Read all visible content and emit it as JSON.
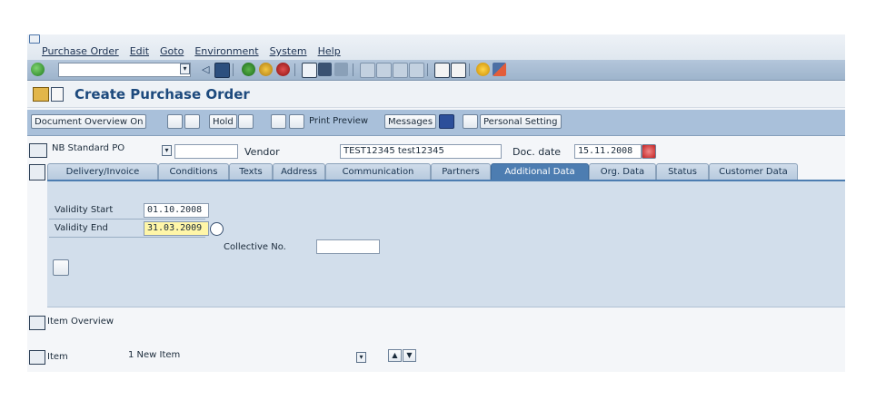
{
  "menu": [
    "Purchase Order",
    "Edit",
    "Goto",
    "Environment",
    "System",
    "Help"
  ],
  "title": "Create Purchase Order",
  "toolbar": {
    "doc_overview": "Document Overview On",
    "hold": "Hold",
    "print_preview": "Print Preview",
    "messages": "Messages",
    "personal_setting": "Personal Setting"
  },
  "header": {
    "po_type": "NB Standard PO",
    "po_number": "",
    "vendor_label": "Vendor",
    "vendor_value": "TEST12345 test12345",
    "doc_date_label": "Doc. date",
    "doc_date_value": "15.11.2008"
  },
  "tabs": [
    "Delivery/Invoice",
    "Conditions",
    "Texts",
    "Address",
    "Communication",
    "Partners",
    "Additional Data",
    "Org. Data",
    "Status",
    "Customer Data"
  ],
  "active_tab": "Additional Data",
  "additional": {
    "validity_start_label": "Validity Start",
    "validity_start_value": "01.10.2008",
    "validity_end_label": "Validity End",
    "validity_end_value": "31.03.2009",
    "collective_label": "Collective No.",
    "collective_value": ""
  },
  "item_overview_label": "Item Overview",
  "item": {
    "label": "Item",
    "value": "1 New Item"
  },
  "colors": {
    "accent": "#4d7db1",
    "title": "#1d4a7d",
    "toolbar": "#a9c0da",
    "panel": "#d2deeb",
    "highlight": "#fff6a8"
  },
  "icons": [
    "enter-icon",
    "save-icon",
    "back-icon",
    "exit-icon",
    "cancel-icon",
    "print-icon",
    "find-icon",
    "help-icon"
  ]
}
